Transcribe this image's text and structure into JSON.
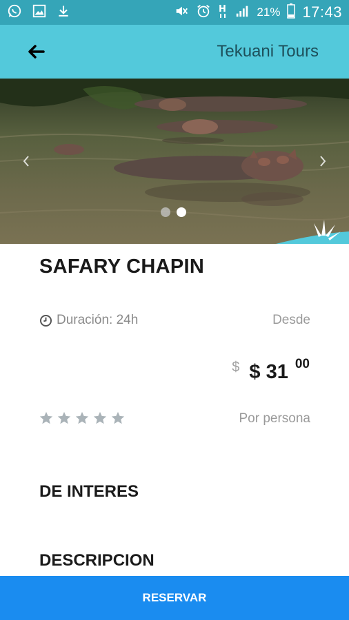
{
  "status_bar": {
    "battery_percent": "21%",
    "time": "17:43",
    "left_icons": [
      "whatsapp-icon",
      "image-icon",
      "download-icon"
    ],
    "right_icons": [
      "mute-icon",
      "alarm-icon",
      "network-h-icon",
      "signal-icon",
      "battery-icon"
    ]
  },
  "app_bar": {
    "title": "Tekuani Tours",
    "back_icon": "arrow-left-icon",
    "color": "#53c9db"
  },
  "gallery": {
    "total_slides": 2,
    "active_slide": 2
  },
  "tour": {
    "title": "SAFARY CHAPIN",
    "duration_label": "Duración: 24h",
    "desde_label": "Desde",
    "currency_symbol": "$",
    "price_main": "$ 31",
    "price_cents": "00",
    "per_person_label": "Por persona",
    "rating_stars": 5,
    "rating_value": 0
  },
  "sections": {
    "interest_title": "DE INTERES",
    "description_title": "DESCRIPCION"
  },
  "reserve_button": {
    "label": "RESERVAR",
    "color": "#1a8cf0"
  }
}
